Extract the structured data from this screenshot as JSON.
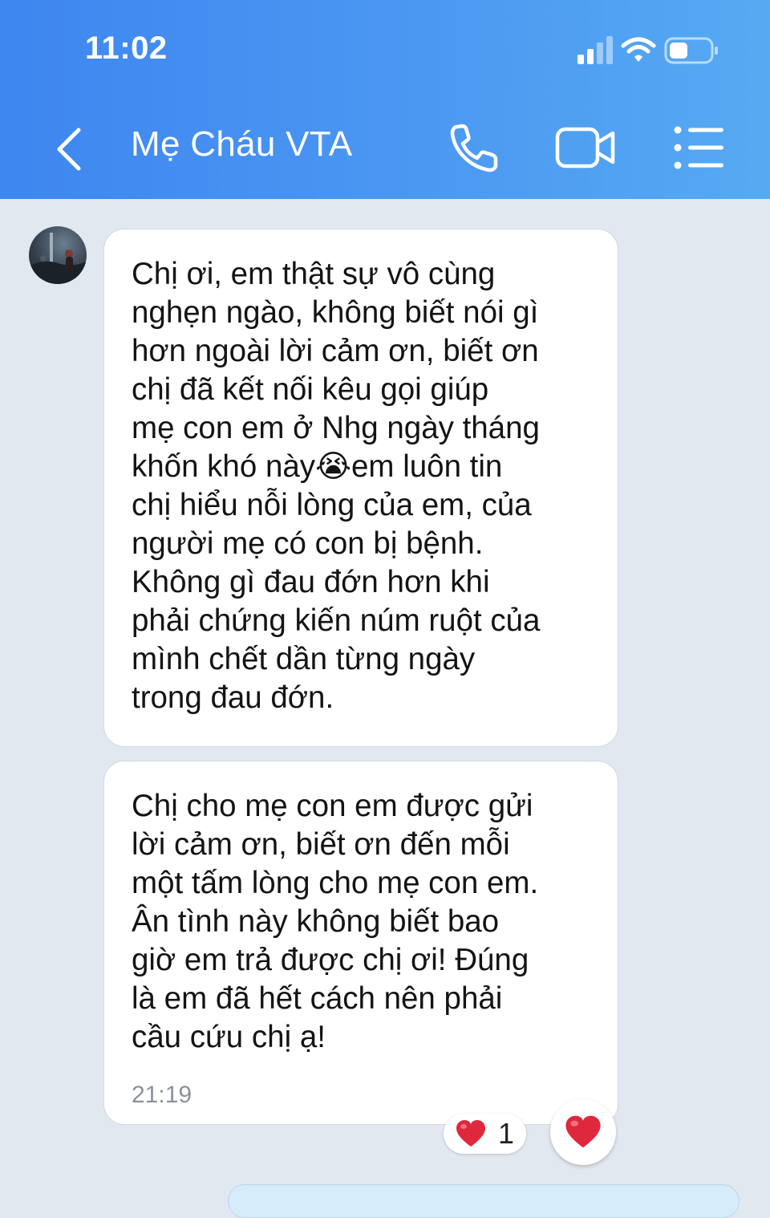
{
  "status_bar": {
    "time": "11:02",
    "icons": [
      "cellular-signal-icon",
      "wifi-icon",
      "battery-icon"
    ]
  },
  "header": {
    "title": "Mẹ Cháu VTA",
    "buttons": [
      "back-icon",
      "phone-icon",
      "video-call-icon",
      "menu-icon"
    ]
  },
  "messages": [
    {
      "sender": "contact",
      "text": "Chị ơi, em thật sự vô cùng\nnghẹn ngào, không biết nói gì\nhơn ngoài lời cảm ơn, biết ơn\nchị đã kết nối kêu gọi giúp\nmẹ con em ở Nhg ngày tháng\nkhốn khó này😭em luôn tin\nchị hiểu nỗi lòng của em, của\nngười mẹ có con bị bệnh.\nKhông gì đau đớn hơn khi\nphải chứng kiến núm ruột của\nmình chết dần từng ngày\ntrong đau đớn."
    },
    {
      "sender": "contact",
      "text": "Chị cho mẹ con em được gửi\nlời cảm ơn, biết ơn đến mỗi\nmột tấm lòng cho mẹ con em.\nÂn tình này không biết bao\ngiờ em trả được chị ơi! Đúng\nlà em đã hết cách nên phải\ncầu cứu chị ạ!",
      "time": "21:19",
      "reaction": {
        "emoji": "❤️",
        "count": "1"
      }
    }
  ],
  "colors": {
    "header_start": "#3e86f0",
    "header_end": "#56aaf2",
    "chat_background": "#e2e8ef",
    "bubble": "#ffffff",
    "heart": "#e0283d"
  }
}
